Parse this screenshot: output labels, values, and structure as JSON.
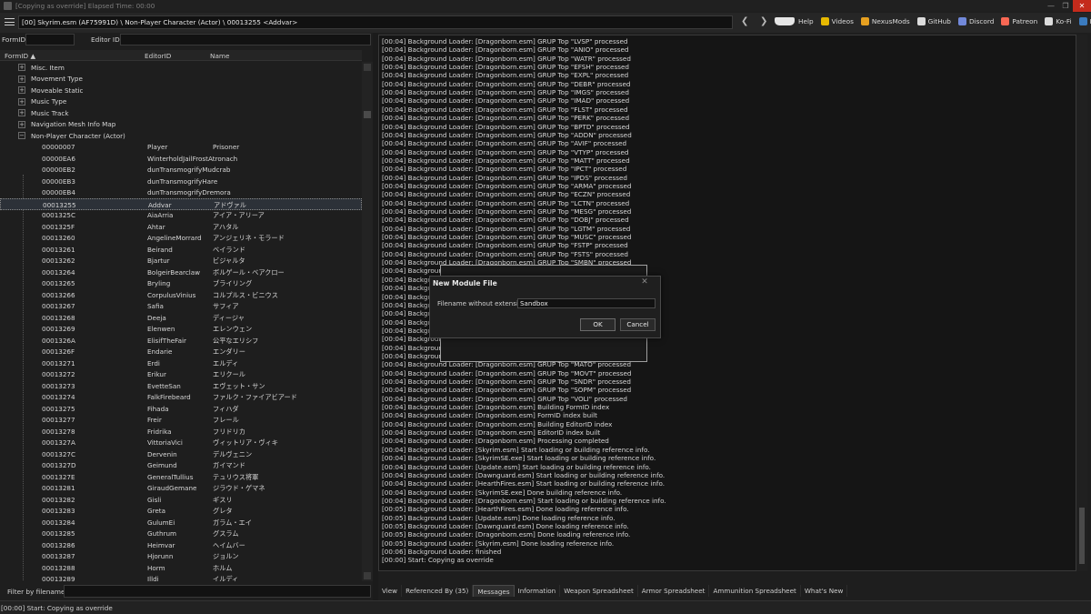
{
  "window": {
    "title": "[Copying as override] Elapsed Time: 00:00",
    "controls": [
      "—",
      "❐",
      "✕"
    ]
  },
  "toolbar": {
    "path": "[00] Skyrim.esm (AF75991D) \\ Non-Player Character (Actor) \\ 00013255 <Addvar>",
    "back": "❮",
    "forward": "❯",
    "links": [
      {
        "label": "Help",
        "icon": "help-icon",
        "color": "#e6e6e6"
      },
      {
        "label": "Videos",
        "icon": "videos-icon",
        "color": "#e6b800"
      },
      {
        "label": "NexusMods",
        "icon": "nexusmods-icon",
        "color": "#e6a020"
      },
      {
        "label": "GitHub",
        "icon": "github-icon",
        "color": "#dcdcdc"
      },
      {
        "label": "Discord",
        "icon": "discord-icon",
        "color": "#7289da"
      },
      {
        "label": "Patreon",
        "icon": "patreon-icon",
        "color": "#f96854"
      },
      {
        "label": "Ko-Fi",
        "icon": "kofi-icon",
        "color": "#dcdcdc"
      },
      {
        "label": "PayPal",
        "icon": "paypal-icon",
        "color": "#3b7bbf"
      }
    ]
  },
  "left_panel": {
    "formid_label": "FormID",
    "editorid_label": "Editor ID",
    "columns": {
      "formid": "FormID ▲",
      "editorid": "EditorID",
      "name": "Name"
    },
    "groups": [
      "Misc. Item",
      "Movement Type",
      "Moveable Static",
      "Music Type",
      "Music Track",
      "Navigation Mesh Info Map",
      "Non-Player Character (Actor)"
    ],
    "records": [
      {
        "formid": "00000007",
        "editorid": "Player",
        "name": "Prisoner"
      },
      {
        "formid": "00000EA6",
        "editorid": "WinterholdJailFrostAtronach",
        "name": ""
      },
      {
        "formid": "00000EB2",
        "editorid": "dunTransmogrifyMudcrab",
        "name": ""
      },
      {
        "formid": "00000EB3",
        "editorid": "dunTransmogrifyHare",
        "name": ""
      },
      {
        "formid": "00000EB4",
        "editorid": "dunTransmogrifyDremora",
        "name": ""
      },
      {
        "formid": "00013255",
        "editorid": "Addvar",
        "name": "アドヴァル"
      },
      {
        "formid": "0001325C",
        "editorid": "AiaArria",
        "name": "アイア・アリーア"
      },
      {
        "formid": "0001325F",
        "editorid": "Ahtar",
        "name": "アハタル"
      },
      {
        "formid": "00013260",
        "editorid": "AngelineMorrard",
        "name": "アンジェリネ・モラード"
      },
      {
        "formid": "00013261",
        "editorid": "Beirand",
        "name": "ベイランド"
      },
      {
        "formid": "00013262",
        "editorid": "Bjartur",
        "name": "ビジャルタ"
      },
      {
        "formid": "00013264",
        "editorid": "BolgeirBearclaw",
        "name": "ボルゲール・ベアクロー"
      },
      {
        "formid": "00013265",
        "editorid": "Bryling",
        "name": "ブライリング"
      },
      {
        "formid": "00013266",
        "editorid": "CorpulusVinius",
        "name": "コルプルス・ビニウス"
      },
      {
        "formid": "00013267",
        "editorid": "Safia",
        "name": "サフィア"
      },
      {
        "formid": "00013268",
        "editorid": "Deeja",
        "name": "ディージャ"
      },
      {
        "formid": "00013269",
        "editorid": "Elenwen",
        "name": "エレンウェン"
      },
      {
        "formid": "0001326A",
        "editorid": "ElisifTheFair",
        "name": "公平なエリシフ"
      },
      {
        "formid": "0001326F",
        "editorid": "Endarie",
        "name": "エンダリー"
      },
      {
        "formid": "00013271",
        "editorid": "Erdi",
        "name": "エルディ"
      },
      {
        "formid": "00013272",
        "editorid": "Erikur",
        "name": "エリクール"
      },
      {
        "formid": "00013273",
        "editorid": "EvetteSan",
        "name": "エヴェット・サン"
      },
      {
        "formid": "00013274",
        "editorid": "FalkFirebeard",
        "name": "ファルク・ファイアビアード"
      },
      {
        "formid": "00013275",
        "editorid": "Fihada",
        "name": "フィハダ"
      },
      {
        "formid": "00013277",
        "editorid": "Freir",
        "name": "フレール"
      },
      {
        "formid": "00013278",
        "editorid": "Fridrika",
        "name": "フリドリカ"
      },
      {
        "formid": "0001327A",
        "editorid": "VittoriaVici",
        "name": "ヴィットリア・ヴィキ"
      },
      {
        "formid": "0001327C",
        "editorid": "Dervenin",
        "name": "デルヴェニン"
      },
      {
        "formid": "0001327D",
        "editorid": "Geimund",
        "name": "ガイマンド"
      },
      {
        "formid": "0001327E",
        "editorid": "GeneralTullius",
        "name": "テュリウス将軍"
      },
      {
        "formid": "00013281",
        "editorid": "GiraudGemane",
        "name": "ジラウド・ゲマネ"
      },
      {
        "formid": "00013282",
        "editorid": "Gisli",
        "name": "ギスリ"
      },
      {
        "formid": "00013283",
        "editorid": "Greta",
        "name": "グレタ"
      },
      {
        "formid": "00013284",
        "editorid": "GulumEi",
        "name": "ガラム・エイ"
      },
      {
        "formid": "00013285",
        "editorid": "Guthrum",
        "name": "グスラム"
      },
      {
        "formid": "00013286",
        "editorid": "Heimvar",
        "name": "ヘイムバー"
      },
      {
        "formid": "00013287",
        "editorid": "Hjorunn",
        "name": "ジョルン"
      },
      {
        "formid": "00013288",
        "editorid": "Horm",
        "name": "ホルム"
      },
      {
        "formid": "00013289",
        "editorid": "Illdi",
        "name": "イルディ"
      }
    ],
    "selected_index": 5,
    "filter_label": "Filter by filename:"
  },
  "log_lines": [
    "[00:04] Background Loader: [Dragonborn.esm] GRUP Top \"LVSP\" processed",
    "[00:04] Background Loader: [Dragonborn.esm] GRUP Top \"ANIO\" processed",
    "[00:04] Background Loader: [Dragonborn.esm] GRUP Top \"WATR\" processed",
    "[00:04] Background Loader: [Dragonborn.esm] GRUP Top \"EFSH\" processed",
    "[00:04] Background Loader: [Dragonborn.esm] GRUP Top \"EXPL\" processed",
    "[00:04] Background Loader: [Dragonborn.esm] GRUP Top \"DEBR\" processed",
    "[00:04] Background Loader: [Dragonborn.esm] GRUP Top \"IMGS\" processed",
    "[00:04] Background Loader: [Dragonborn.esm] GRUP Top \"IMAD\" processed",
    "[00:04] Background Loader: [Dragonborn.esm] GRUP Top \"FLST\" processed",
    "[00:04] Background Loader: [Dragonborn.esm] GRUP Top \"PERK\" processed",
    "[00:04] Background Loader: [Dragonborn.esm] GRUP Top \"BPTD\" processed",
    "[00:04] Background Loader: [Dragonborn.esm] GRUP Top \"ADDN\" processed",
    "[00:04] Background Loader: [Dragonborn.esm] GRUP Top \"AVIF\" processed",
    "[00:04] Background Loader: [Dragonborn.esm] GRUP Top \"VTYP\" processed",
    "[00:04] Background Loader: [Dragonborn.esm] GRUP Top \"MATT\" processed",
    "[00:04] Background Loader: [Dragonborn.esm] GRUP Top \"IPCT\" processed",
    "[00:04] Background Loader: [Dragonborn.esm] GRUP Top \"IPDS\" processed",
    "[00:04] Background Loader: [Dragonborn.esm] GRUP Top \"ARMA\" processed",
    "[00:04] Background Loader: [Dragonborn.esm] GRUP Top \"ECZN\" processed",
    "[00:04] Background Loader: [Dragonborn.esm] GRUP Top \"LCTN\" processed",
    "[00:04] Background Loader: [Dragonborn.esm] GRUP Top \"MESG\" processed",
    "[00:04] Background Loader: [Dragonborn.esm] GRUP Top \"DOBJ\" processed",
    "[00:04] Background Loader: [Dragonborn.esm] GRUP Top \"LGTM\" processed",
    "[00:04] Background Loader: [Dragonborn.esm] GRUP Top \"MUSC\" processed",
    "[00:04] Background Loader: [Dragonborn.esm] GRUP Top \"FSTP\" processed",
    "[00:04] Background Loader: [Dragonborn.esm] GRUP Top \"FSTS\" processed",
    "[00:04] Background Loader: [Dragonborn.esm] GRUP Top \"SMBN\" processed",
    "[00:04] Background L",
    "[00:04] Background L",
    "[00:04] Background L",
    "[00:04] Background L",
    "[00:04] Background L",
    "[00:04] Background L",
    "[00:04] Background L",
    "[00:04] Background L",
    "[00:04] Background L",
    "[00:04] Background L",
    "[00:04] Background L",
    "[00:04] Background Loader: [Dragonborn.esm] GRUP Top \"MATO\" processed",
    "[00:04] Background Loader: [Dragonborn.esm] GRUP Top \"MOVT\" processed",
    "[00:04] Background Loader: [Dragonborn.esm] GRUP Top \"SNDR\" processed",
    "[00:04] Background Loader: [Dragonborn.esm] GRUP Top \"SOPM\" processed",
    "[00:04] Background Loader: [Dragonborn.esm] GRUP Top \"VOLI\" processed",
    "[00:04] Background Loader: [Dragonborn.esm] Building FormID index",
    "[00:04] Background Loader: [Dragonborn.esm] FormID index built",
    "[00:04] Background Loader: [Dragonborn.esm] Building EditorID index",
    "[00:04] Background Loader: [Dragonborn.esm] EditorID index built",
    "[00:04] Background Loader: [Dragonborn.esm] Processing completed",
    "[00:04] Background Loader: [Skyrim.esm] Start loading or building reference info.",
    "[00:04] Background Loader: [SkyrimSE.exe] Start loading or building reference info.",
    "[00:04] Background Loader: [Update.esm] Start loading or building reference info.",
    "[00:04] Background Loader: [Dawnguard.esm] Start loading or building reference info.",
    "[00:04] Background Loader: [HearthFires.esm] Start loading or building reference info.",
    "[00:04] Background Loader: [SkyrimSE.exe] Done building reference info.",
    "[00:04] Background Loader: [Dragonborn.esm] Start loading or building reference info.",
    "[00:05] Background Loader: [HearthFires.esm] Done loading reference info.",
    "[00:05] Background Loader: [Update.esm] Done loading reference info.",
    "[00:05] Background Loader: [Dawnguard.esm] Done loading reference info.",
    "[00:05] Background Loader: [Dragonborn.esm] Done loading reference info.",
    "[00:05] Background Loader: [Skyrim.esm] Done loading reference info.",
    "[00:06] Background Loader: finished",
    "[00:00] Start: Copying as override"
  ],
  "tabs": [
    {
      "label": "View",
      "active": false
    },
    {
      "label": "Referenced By (35)",
      "active": false
    },
    {
      "label": "Messages",
      "active": true
    },
    {
      "label": "Information",
      "active": false
    },
    {
      "label": "Weapon Spreadsheet",
      "active": false
    },
    {
      "label": "Armor Spreadsheet",
      "active": false
    },
    {
      "label": "Ammunition Spreadsheet",
      "active": false
    },
    {
      "label": "What's New",
      "active": false
    }
  ],
  "status_text": "[00:00] Start: Copying as override",
  "dialog": {
    "title": "New Module File",
    "label": "Filename without extension:",
    "value": "Sandbox",
    "ok": "OK",
    "cancel": "Cancel",
    "close": "✕"
  }
}
